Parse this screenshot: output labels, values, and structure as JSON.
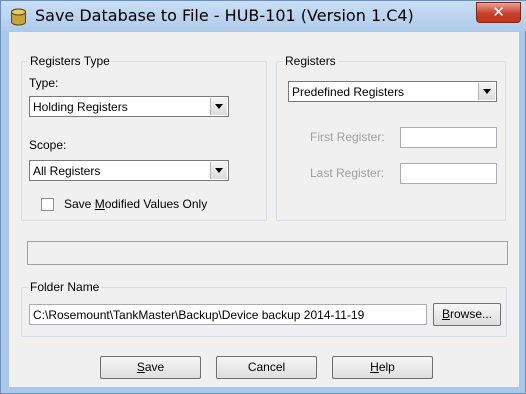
{
  "window": {
    "title": "Save Database to File - HUB-101 (Version 1.C4)",
    "close_label": "✕"
  },
  "registers_type": {
    "legend": "Registers Type",
    "type_label": "Type:",
    "type_value": "Holding Registers",
    "scope_label": "Scope:",
    "scope_value": "All Registers",
    "save_modified_prefix": "Save ",
    "save_modified_accel": "M",
    "save_modified_suffix": "odified Values Only"
  },
  "registers": {
    "legend": "Registers",
    "selection_value": "Predefined Registers",
    "first_register_label": "First Register:",
    "first_register_value": "",
    "last_register_label": "Last Register:",
    "last_register_value": ""
  },
  "folder": {
    "legend": "Folder Name",
    "path": "C:\\Rosemount\\TankMaster\\Backup\\Device backup 2014-11-19",
    "browse_accel": "B",
    "browse_rest": "rowse..."
  },
  "buttons": {
    "save_accel": "S",
    "save_rest": "ave",
    "cancel_label": "Cancel",
    "help_accel": "H",
    "help_rest": "elp"
  }
}
